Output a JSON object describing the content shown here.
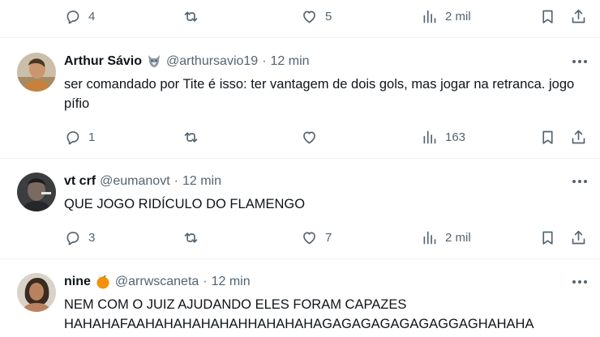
{
  "top_actions": {
    "replies": "4",
    "reposts": "",
    "likes": "5",
    "views": "2 mil"
  },
  "tweets": [
    {
      "name": "Arthur Sávio",
      "badge": "wolf-emoji",
      "handle": "@arthursavio19",
      "separator": "·",
      "time": "12 min",
      "text": "ser comandado por Tite é isso: ter vantagem de dois gols, mas jogar na retranca. jogo pífio",
      "replies": "1",
      "reposts": "",
      "likes": "",
      "views": "163"
    },
    {
      "name": "vt crf",
      "handle": "@eumanovt",
      "separator": "·",
      "time": "12 min",
      "text": "QUE JOGO RIDÍCULO DO FLAMENGO",
      "replies": "3",
      "reposts": "",
      "likes": "7",
      "views": "2 mil"
    },
    {
      "name": "nine",
      "badge": "orange-emoji",
      "handle": "@arrwscaneta",
      "separator": "·",
      "time": "12 min",
      "text": "NEM COM O JUIZ AJUDANDO ELES FORAM CAPAZES\nHAHAHAFAAHAHAHAHAHAHHAHAHAHAGAGAGAGAGAGAGGAGHAHAHA"
    }
  ],
  "colors": {
    "text": "#0f1419",
    "muted": "#536471",
    "divider": "#eff3f4"
  }
}
